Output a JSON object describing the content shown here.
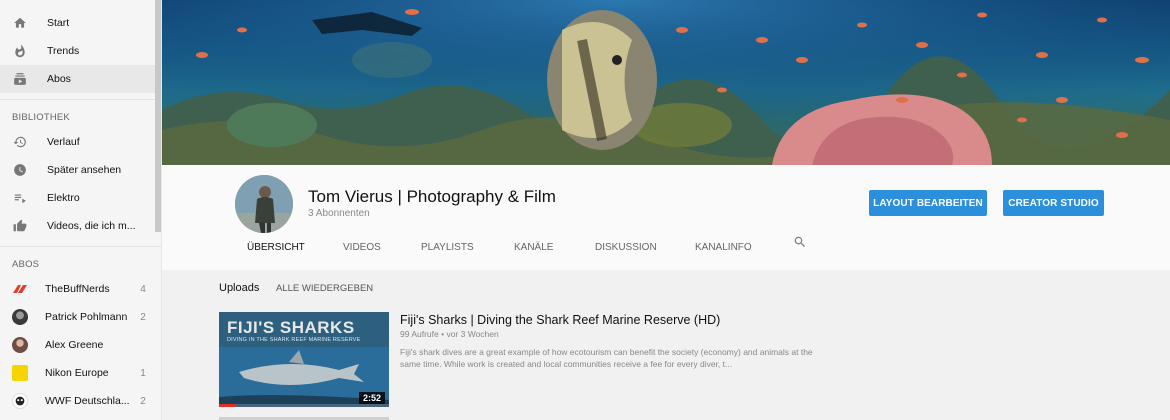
{
  "sidebar": {
    "nav": [
      {
        "label": "Start",
        "icon": "home-icon"
      },
      {
        "label": "Trends",
        "icon": "flame-icon"
      },
      {
        "label": "Abos",
        "icon": "subscriptions-icon",
        "active": true
      }
    ],
    "library_title": "BIBLIOTHEK",
    "library": [
      {
        "label": "Verlauf",
        "icon": "history-icon"
      },
      {
        "label": "Später ansehen",
        "icon": "clock-icon"
      },
      {
        "label": "Elektro",
        "icon": "playlist-icon"
      },
      {
        "label": "Videos, die ich m...",
        "icon": "thumbs-up-icon"
      }
    ],
    "subs_title": "ABOS",
    "subs": [
      {
        "name": "TheBuffNerds",
        "count": "4",
        "color": "#e33b2e"
      },
      {
        "name": "Patrick Pohlmann",
        "count": "2",
        "color": "#3a3a3a"
      },
      {
        "name": "Alex Greene",
        "count": "",
        "color": "#b08070"
      },
      {
        "name": "Nikon Europe",
        "count": "1",
        "color": "#f5d400"
      },
      {
        "name": "WWF Deutschla...",
        "count": "2",
        "color": "#222222"
      }
    ]
  },
  "channel": {
    "title": "Tom Vierus | Photography & Film",
    "subscribers": "3 Abonnenten",
    "layout_button": "LAYOUT BEARBEITEN",
    "studio_button": "CREATOR STUDIO",
    "tabs": [
      "ÜBERSICHT",
      "VIDEOS",
      "PLAYLISTS",
      "KANÄLE",
      "DISKUSSION",
      "KANALINFO"
    ],
    "accent": "#2b8fdb"
  },
  "uploads": {
    "title": "Uploads",
    "play_all": "ALLE WIEDERGEBEN",
    "video": {
      "thumb_title": "FIJI'S SHARKS",
      "thumb_subtitle": "DIVING IN THE SHARK REEF MARINE RESERVE",
      "duration": "2:52",
      "progress": 0.1,
      "title": "Fiji's Sharks | Diving the Shark Reef Marine Reserve (HD)",
      "meta": "99 Aufrufe • vor 3 Wochen",
      "description": "Fiji's shark dives are a great example of how ecotourism can benefit the society (economy) and animals at the same time. While work is created and local communities receive a fee for every diver, t..."
    }
  }
}
